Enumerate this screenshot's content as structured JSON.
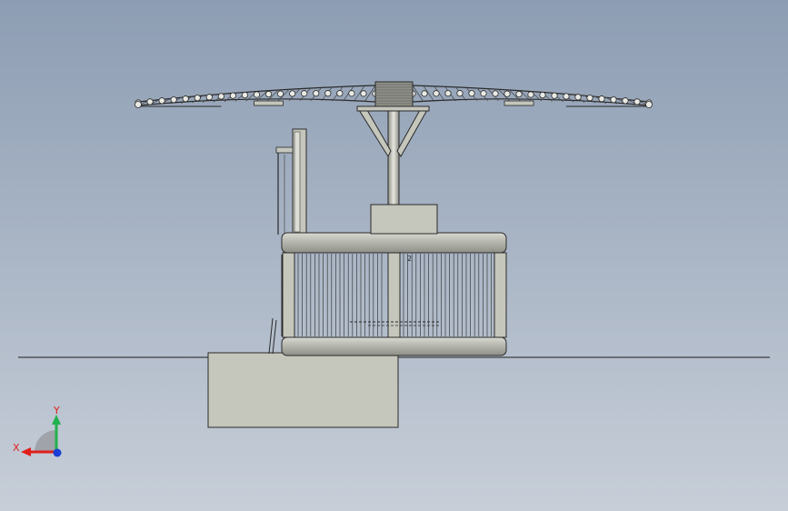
{
  "model_view": {
    "part_marker": "2"
  },
  "triad": {
    "x_label": "X",
    "y_label": "Y",
    "x_color": "#e0201b",
    "y_color": "#22b14c",
    "z_color": "#1a3fd6"
  },
  "colors": {
    "background_top": "#8d9db3",
    "background_bottom": "#c7ced8",
    "part_fill": "#c5c6bc",
    "part_shade": "#9a9b92",
    "edge": "#2a2a2a",
    "rib_fill": "#e9eae4"
  },
  "icons": [
    "triad-icon"
  ]
}
